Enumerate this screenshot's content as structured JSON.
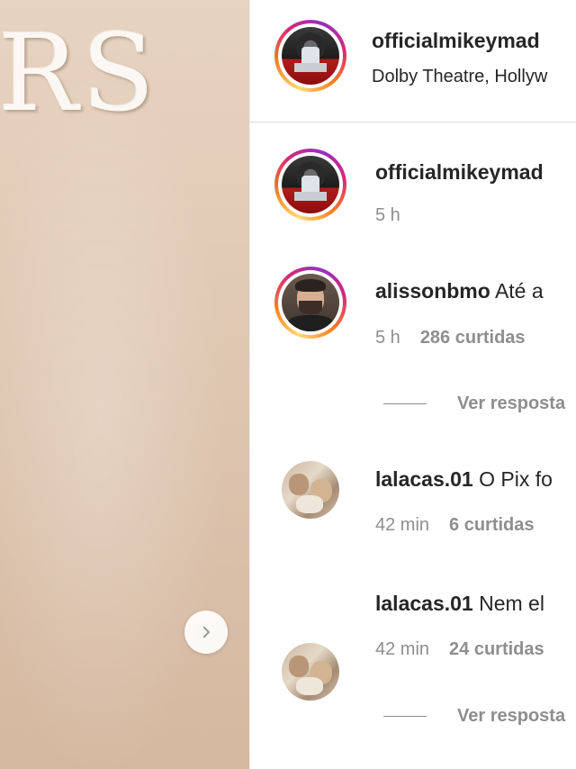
{
  "photo": {
    "overlay_text": "RS",
    "next_icon": "chevron-right-icon"
  },
  "header": {
    "username": "officialmikeymad",
    "location": "Dolby Theatre, Hollyw"
  },
  "caption": {
    "username": "officialmikeymad",
    "time": "5 h"
  },
  "comments": [
    {
      "username": "alissonbmo",
      "text": "Até a",
      "time": "5 h",
      "likes": "286 curtidas",
      "replies": "Ver resposta"
    },
    {
      "username": "lalacas.01",
      "text": "O Pix fo",
      "time": "42 min",
      "likes": "6 curtidas"
    },
    {
      "username": "lalacas.01",
      "text": "Nem el",
      "time": "42 min",
      "likes": "24 curtidas",
      "replies": "Ver resposta"
    }
  ],
  "colors": {
    "text": "#262626",
    "muted": "#8e8e8e",
    "divider": "#dbdbdb",
    "story_ring": [
      "#feda75",
      "#fa7e1e",
      "#d62976",
      "#962fbf"
    ]
  }
}
